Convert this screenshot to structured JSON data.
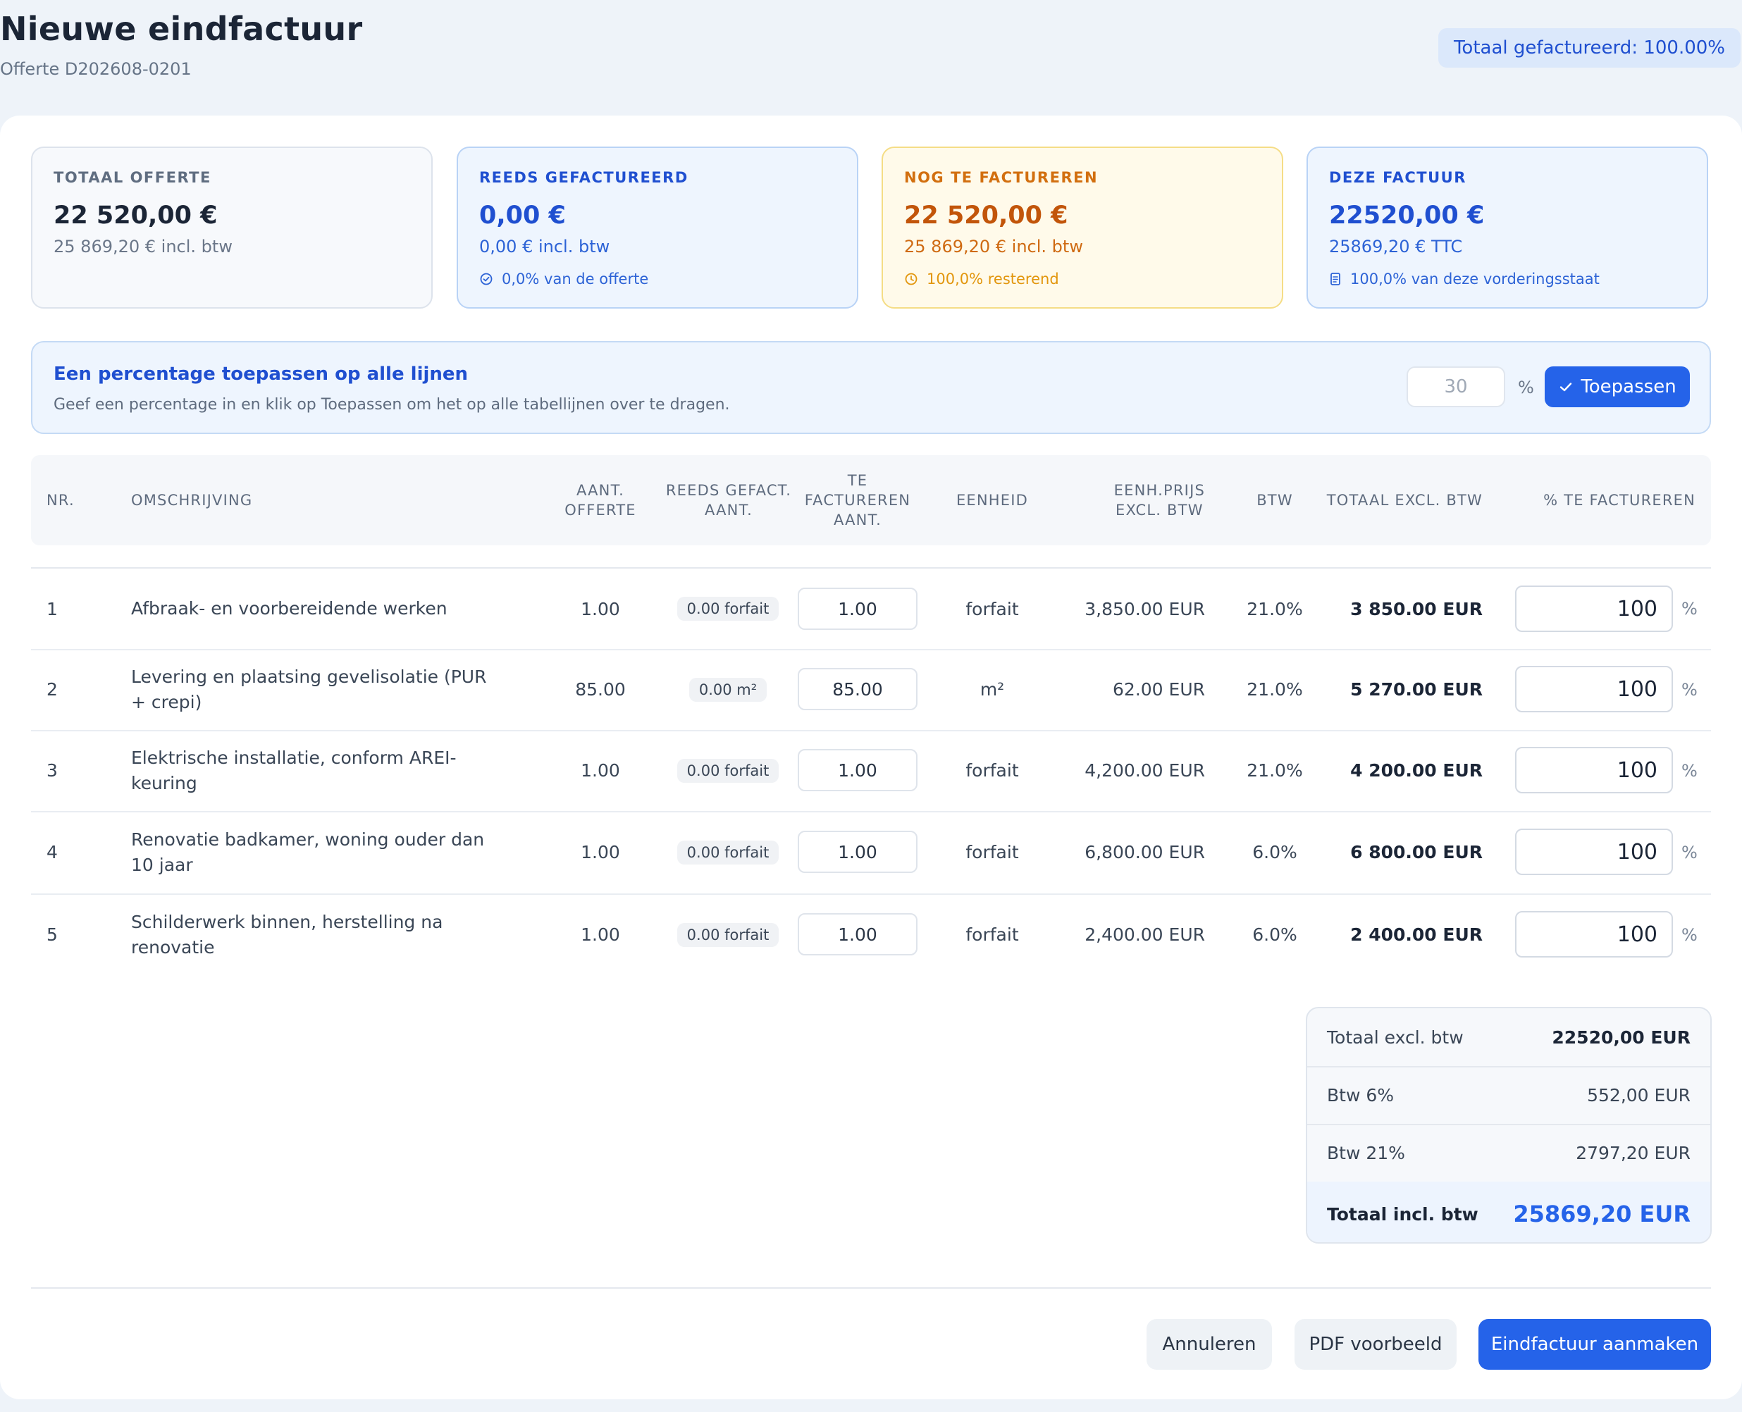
{
  "header": {
    "title": "Nieuwe eindfactuur",
    "subtitle": "Offerte D202608-0201",
    "badge": "Totaal gefactureerd: 100.00%"
  },
  "stats": [
    {
      "label": "TOTAAL OFFERTE",
      "value": "22 520,00 €",
      "sub": "25 869,20 € incl. btw",
      "note": ""
    },
    {
      "label": "REEDS GEFACTUREERD",
      "value": "0,00 €",
      "sub": "0,00 € incl. btw",
      "note": "0,0% van de offerte",
      "icon": "check-circle-icon"
    },
    {
      "label": "NOG TE FACTUREREN",
      "value": "22 520,00 €",
      "sub": "25 869,20 € incl. btw",
      "note": "100,0% resterend",
      "icon": "clock-icon"
    },
    {
      "label": "DEZE FACTUUR",
      "value": "22520,00 €",
      "sub": "25869,20 € TTC",
      "note": "100,0% van deze vorderingsstaat",
      "icon": "document-icon"
    }
  ],
  "apply": {
    "title": "Een percentage toepassen op alle lijnen",
    "description": "Geef een percentage in en klik op Toepassen om het op alle tabellijnen over te dragen.",
    "placeholder": "30",
    "percent_sign": "%",
    "button_label": "Toepassen"
  },
  "table": {
    "headers": {
      "nr": "NR.",
      "desc": "OMSCHRIJVING",
      "qty_line1": "AANT.",
      "qty_line2": "OFFERTE",
      "done_line1": "REEDS GEFACT.",
      "done_line2": "AANT.",
      "inv_line1": "TE",
      "inv_line2": "FACTUREREN",
      "inv_line3": "AANT.",
      "unit": "EENHEID",
      "price_line1": "EENH.PRIJS",
      "price_line2": "EXCL. BTW",
      "vat": "BTW",
      "total": "TOTAAL EXCL. BTW",
      "pct": "% TE FACTUREREN"
    },
    "rows": [
      {
        "nr": "1",
        "desc": "Afbraak- en voorbereidende werken",
        "qty": "1.00",
        "done": "0.00 forfait",
        "invoice_qty": "1.00",
        "unit": "forfait",
        "price": "3,850.00 EUR",
        "vat": "21.0%",
        "total": "3 850.00 EUR",
        "pct": "100",
        "pct_sign": "%"
      },
      {
        "nr": "2",
        "desc": "Levering en plaatsing gevelisolatie (PUR + crepi)",
        "qty": "85.00",
        "done": "0.00 m²",
        "invoice_qty": "85.00",
        "unit": "m²",
        "price": "62.00 EUR",
        "vat": "21.0%",
        "total": "5 270.00 EUR",
        "pct": "100",
        "pct_sign": "%"
      },
      {
        "nr": "3",
        "desc": "Elektrische installatie, conform AREI-keuring",
        "qty": "1.00",
        "done": "0.00 forfait",
        "invoice_qty": "1.00",
        "unit": "forfait",
        "price": "4,200.00 EUR",
        "vat": "21.0%",
        "total": "4 200.00 EUR",
        "pct": "100",
        "pct_sign": "%"
      },
      {
        "nr": "4",
        "desc": "Renovatie badkamer, woning ouder dan 10 jaar",
        "qty": "1.00",
        "done": "0.00 forfait",
        "invoice_qty": "1.00",
        "unit": "forfait",
        "price": "6,800.00 EUR",
        "vat": "6.0%",
        "total": "6 800.00 EUR",
        "pct": "100",
        "pct_sign": "%"
      },
      {
        "nr": "5",
        "desc": "Schilderwerk binnen, herstelling na renovatie",
        "qty": "1.00",
        "done": "0.00 forfait",
        "invoice_qty": "1.00",
        "unit": "forfait",
        "price": "2,400.00 EUR",
        "vat": "6.0%",
        "total": "2 400.00 EUR",
        "pct": "100",
        "pct_sign": "%"
      }
    ]
  },
  "totals": {
    "excl_label": "Totaal excl. btw",
    "excl_value": "22520,00 EUR",
    "vat6_label": "Btw 6%",
    "vat6_value": "552,00 EUR",
    "vat21_label": "Btw 21%",
    "vat21_value": "2797,20 EUR",
    "incl_label": "Totaal incl. btw",
    "incl_value": "25869,20 EUR"
  },
  "footer": {
    "cancel": "Annuleren",
    "preview": "PDF voorbeeld",
    "create": "Eindfactuur aanmaken"
  },
  "colors": {
    "primary": "#2563e9",
    "info_bg": "#eef5fe",
    "warning_bg": "#fffaea",
    "warning_text": "#c2550a"
  }
}
